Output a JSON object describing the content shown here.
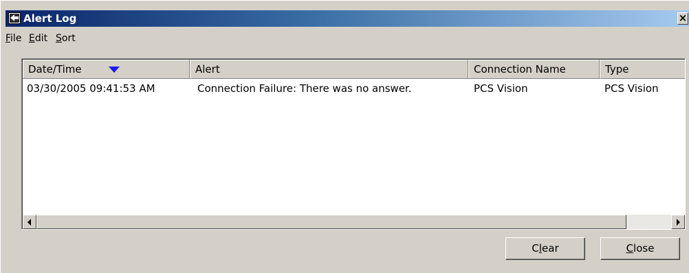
{
  "window": {
    "title": "Alert Log",
    "close_glyph": "×",
    "app_icon": "alert-log-app-icon"
  },
  "menu": {
    "file": {
      "accel": "F",
      "rest": "ile"
    },
    "edit": {
      "accel": "E",
      "rest": "dit"
    },
    "sort": {
      "accel": "S",
      "rest": "ort"
    }
  },
  "table": {
    "columns": [
      {
        "label": "Date/Time",
        "sorted": "descending"
      },
      {
        "label": "Alert"
      },
      {
        "label": "Connection Name"
      },
      {
        "label": "Type"
      }
    ],
    "rows": [
      {
        "date_time": "03/30/2005 09:41:53 AM",
        "alert": "Connection Failure: There was no answer.",
        "connection_name": "PCS Vision",
        "type": "PCS Vision"
      }
    ]
  },
  "buttons": {
    "clear": {
      "before": "C",
      "accel": "l",
      "after": "ear"
    },
    "close": {
      "accel": "C",
      "after": "lose"
    }
  },
  "colors": {
    "titlebar_start": "#0a246a",
    "titlebar_end": "#a6caf0",
    "sort_arrow": "#1a1ae8",
    "face": "#d4d0c8"
  }
}
